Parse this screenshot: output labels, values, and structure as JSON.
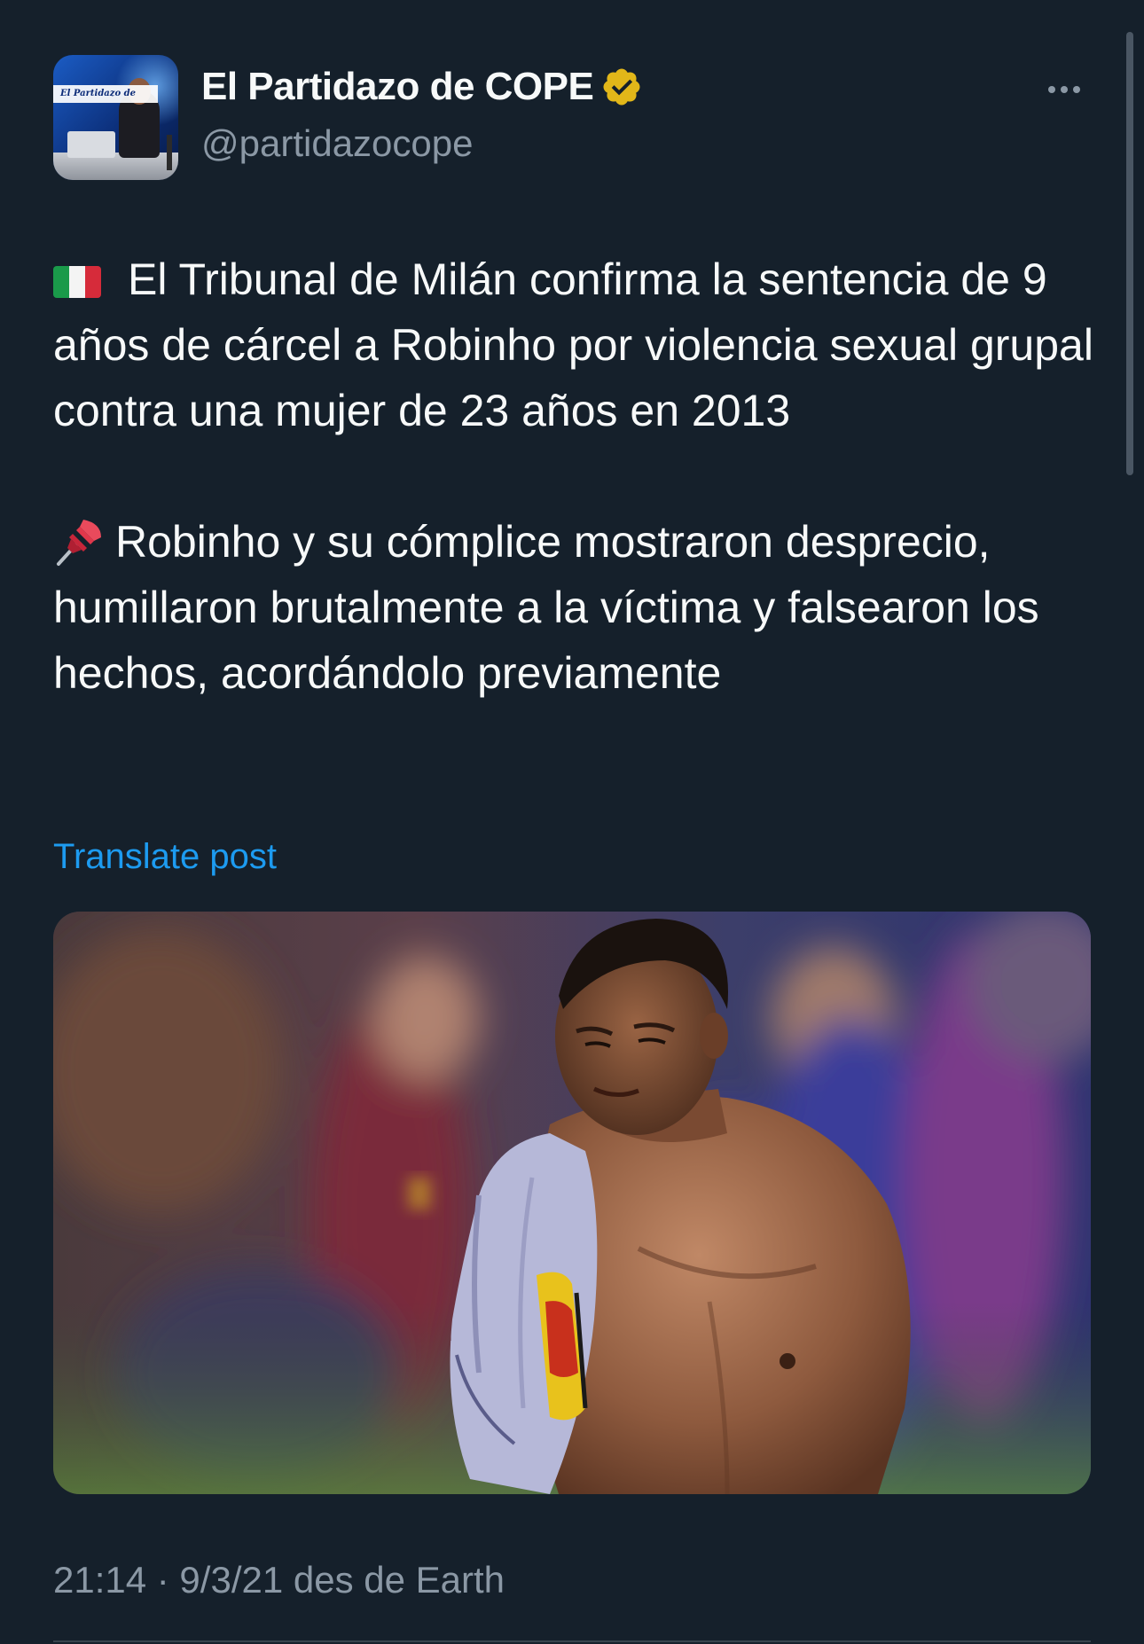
{
  "author": {
    "display_name": "El Partidazo de COPE",
    "handle": "@partidazocope",
    "avatar_banner_text": "El Partidazo de",
    "verified": true,
    "verified_badge_color": "#e2b719"
  },
  "post": {
    "paragraph_1": {
      "icon": "italy-flag-icon",
      "text": "El Tribunal de Milán confirma la sentencia de 9 años de cárcel a Robinho por violencia sexual grupal contra una mujer de 23 años en 2013"
    },
    "paragraph_2": {
      "icon": "pushpin-icon",
      "text": "Robinho y su cómplice mostraron desprecio, humillaron brutalmente a la víctima y falsearon los hechos, acordándolo previamente"
    },
    "translate_label": "Translate post",
    "timestamp": "21:14 · 9/3/21 des de Earth"
  },
  "colors": {
    "background": "#15202b",
    "text_primary": "#f7f9f9",
    "text_secondary": "#8b98a5",
    "link": "#1d9bf0"
  },
  "icons": {
    "more": "more-horizontal-icon",
    "verified": "verified-badge-icon"
  }
}
